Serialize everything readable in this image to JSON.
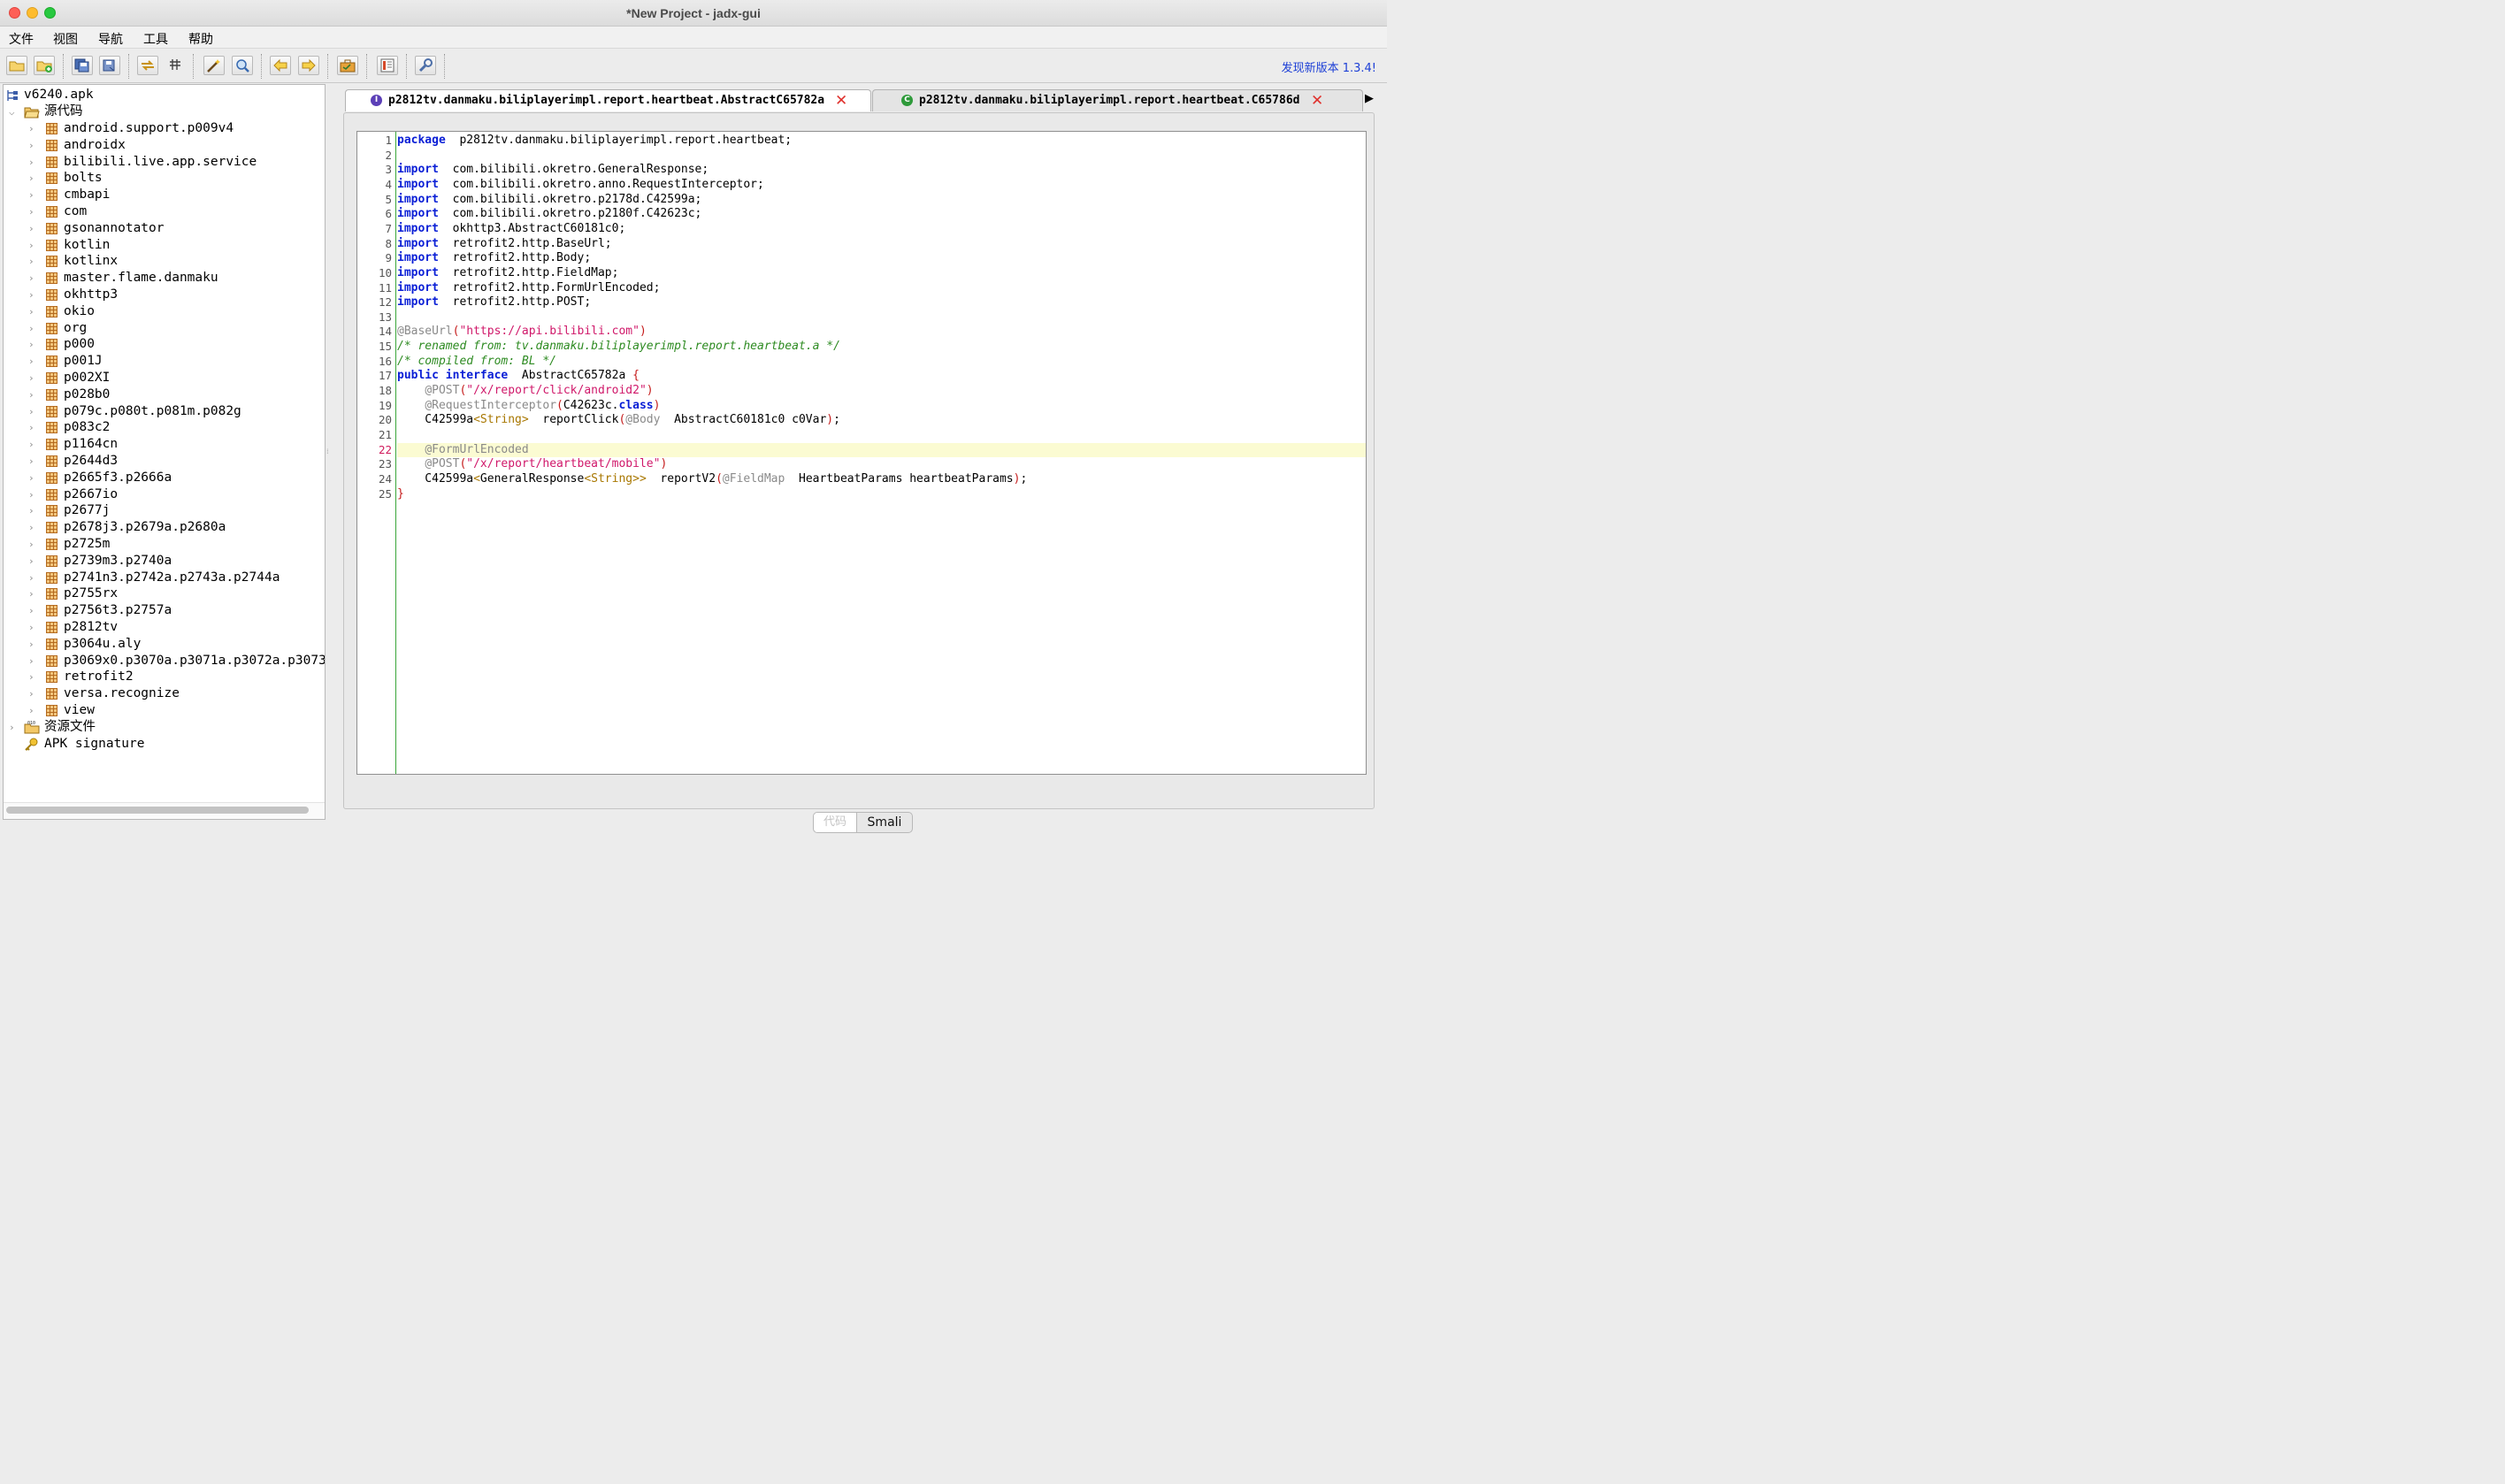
{
  "window": {
    "title": "*New Project - jadx-gui"
  },
  "menu": [
    "文件",
    "视图",
    "导航",
    "工具",
    "帮助"
  ],
  "toolbar": {
    "update_text": "发现新版本 1.3.4!"
  },
  "tree": {
    "root": "v6240.apk",
    "sources_label": "源代码",
    "packages": [
      "android.support.p009v4",
      "androidx",
      "bilibili.live.app.service",
      "bolts",
      "cmbapi",
      "com",
      "gsonannotator",
      "kotlin",
      "kotlinx",
      "master.flame.danmaku",
      "okhttp3",
      "okio",
      "org",
      "p000",
      "p001J",
      "p002XI",
      "p028b0",
      "p079c.p080t.p081m.p082g",
      "p083c2",
      "p1164cn",
      "p2644d3",
      "p2665f3.p2666a",
      "p2667io",
      "p2677j",
      "p2678j3.p2679a.p2680a",
      "p2725m",
      "p2739m3.p2740a",
      "p2741n3.p2742a.p2743a.p2744a",
      "p2755rx",
      "p2756t3.p2757a",
      "p2812tv",
      "p3064u.aly",
      "p3069x0.p3070a.p3071a.p3072a.p3073",
      "retrofit2",
      "versa.recognize",
      "view"
    ],
    "resources_label": "资源文件",
    "signature_label": "APK signature"
  },
  "tabs": [
    {
      "label": "p2812tv.danmaku.biliplayerimpl.report.heartbeat.AbstractC65782a",
      "icon_text": "I",
      "icon_color": "#5b3fb7"
    },
    {
      "label": "p2812tv.danmaku.biliplayerimpl.report.heartbeat.C65786d",
      "icon_text": "C",
      "icon_color": "#2e9a3a"
    }
  ],
  "editor": {
    "current_line": 22,
    "lines": [
      [
        [
          "kw",
          "package"
        ],
        [
          "",
          "  p2812tv.danmaku.biliplayerimpl.report.heartbeat;"
        ]
      ],
      [],
      [
        [
          "kw",
          "import"
        ],
        [
          "",
          "  com.bilibili.okretro.GeneralResponse;"
        ]
      ],
      [
        [
          "kw",
          "import"
        ],
        [
          "",
          "  com.bilibili.okretro.anno.RequestInterceptor;"
        ]
      ],
      [
        [
          "kw",
          "import"
        ],
        [
          "",
          "  com.bilibili.okretro.p2178d.C42599a;"
        ]
      ],
      [
        [
          "kw",
          "import"
        ],
        [
          "",
          "  com.bilibili.okretro.p2180f.C42623c;"
        ]
      ],
      [
        [
          "kw",
          "import"
        ],
        [
          "",
          "  okhttp3.AbstractC60181c0;"
        ]
      ],
      [
        [
          "kw",
          "import"
        ],
        [
          "",
          "  retrofit2.http.BaseUrl;"
        ]
      ],
      [
        [
          "kw",
          "import"
        ],
        [
          "",
          "  retrofit2.http.Body;"
        ]
      ],
      [
        [
          "kw",
          "import"
        ],
        [
          "",
          "  retrofit2.http.FieldMap;"
        ]
      ],
      [
        [
          "kw",
          "import"
        ],
        [
          "",
          "  retrofit2.http.FormUrlEncoded;"
        ]
      ],
      [
        [
          "kw",
          "import"
        ],
        [
          "",
          "  retrofit2.http.POST;"
        ]
      ],
      [],
      [
        [
          "ann",
          "@BaseUrl"
        ],
        [
          "br",
          "("
        ],
        [
          "str",
          "\"https://api.bilibili.com\""
        ],
        [
          "br",
          ")"
        ]
      ],
      [
        [
          "cmt",
          "/* renamed from: tv.danmaku.biliplayerimpl.report.heartbeat.a */"
        ]
      ],
      [
        [
          "cmt",
          "/* compiled from: BL */"
        ]
      ],
      [
        [
          "kw",
          "public interface"
        ],
        [
          "",
          "  AbstractC65782a "
        ],
        [
          "br",
          "{"
        ]
      ],
      [
        [
          "",
          "    "
        ],
        [
          "ann",
          "@POST"
        ],
        [
          "br",
          "("
        ],
        [
          "str",
          "\"/x/report/click/android2\""
        ],
        [
          "br",
          ")"
        ]
      ],
      [
        [
          "",
          "    "
        ],
        [
          "ann",
          "@RequestInterceptor"
        ],
        [
          "br",
          "("
        ],
        [
          "",
          "C42623c."
        ],
        [
          "kw",
          "class"
        ],
        [
          "br",
          ")"
        ]
      ],
      [
        [
          "",
          "    C42599a"
        ],
        [
          "ty",
          "<String>"
        ],
        [
          "",
          "  reportClick"
        ],
        [
          "br",
          "("
        ],
        [
          "ann",
          "@Body"
        ],
        [
          "",
          "  AbstractC60181c0 c0Var"
        ],
        [
          "br",
          ")"
        ],
        [
          "",
          ";"
        ]
      ],
      [],
      [
        [
          "",
          "    "
        ],
        [
          "ann",
          "@FormUrlEncoded"
        ]
      ],
      [
        [
          "",
          "    "
        ],
        [
          "ann",
          "@POST"
        ],
        [
          "br",
          "("
        ],
        [
          "str",
          "\"/x/report/heartbeat/mobile\""
        ],
        [
          "br",
          ")"
        ]
      ],
      [
        [
          "",
          "    C42599a"
        ],
        [
          "ty",
          "<"
        ],
        [
          "",
          "GeneralResponse"
        ],
        [
          "ty",
          "<String>>"
        ],
        [
          "",
          "  reportV2"
        ],
        [
          "br",
          "("
        ],
        [
          "ann",
          "@FieldMap"
        ],
        [
          "",
          "  HeartbeatParams heartbeatParams"
        ],
        [
          "br",
          ")"
        ],
        [
          "",
          ";"
        ]
      ],
      [
        [
          "br",
          "}"
        ]
      ]
    ]
  },
  "bottom_tabs": [
    "代码",
    "Smali"
  ]
}
